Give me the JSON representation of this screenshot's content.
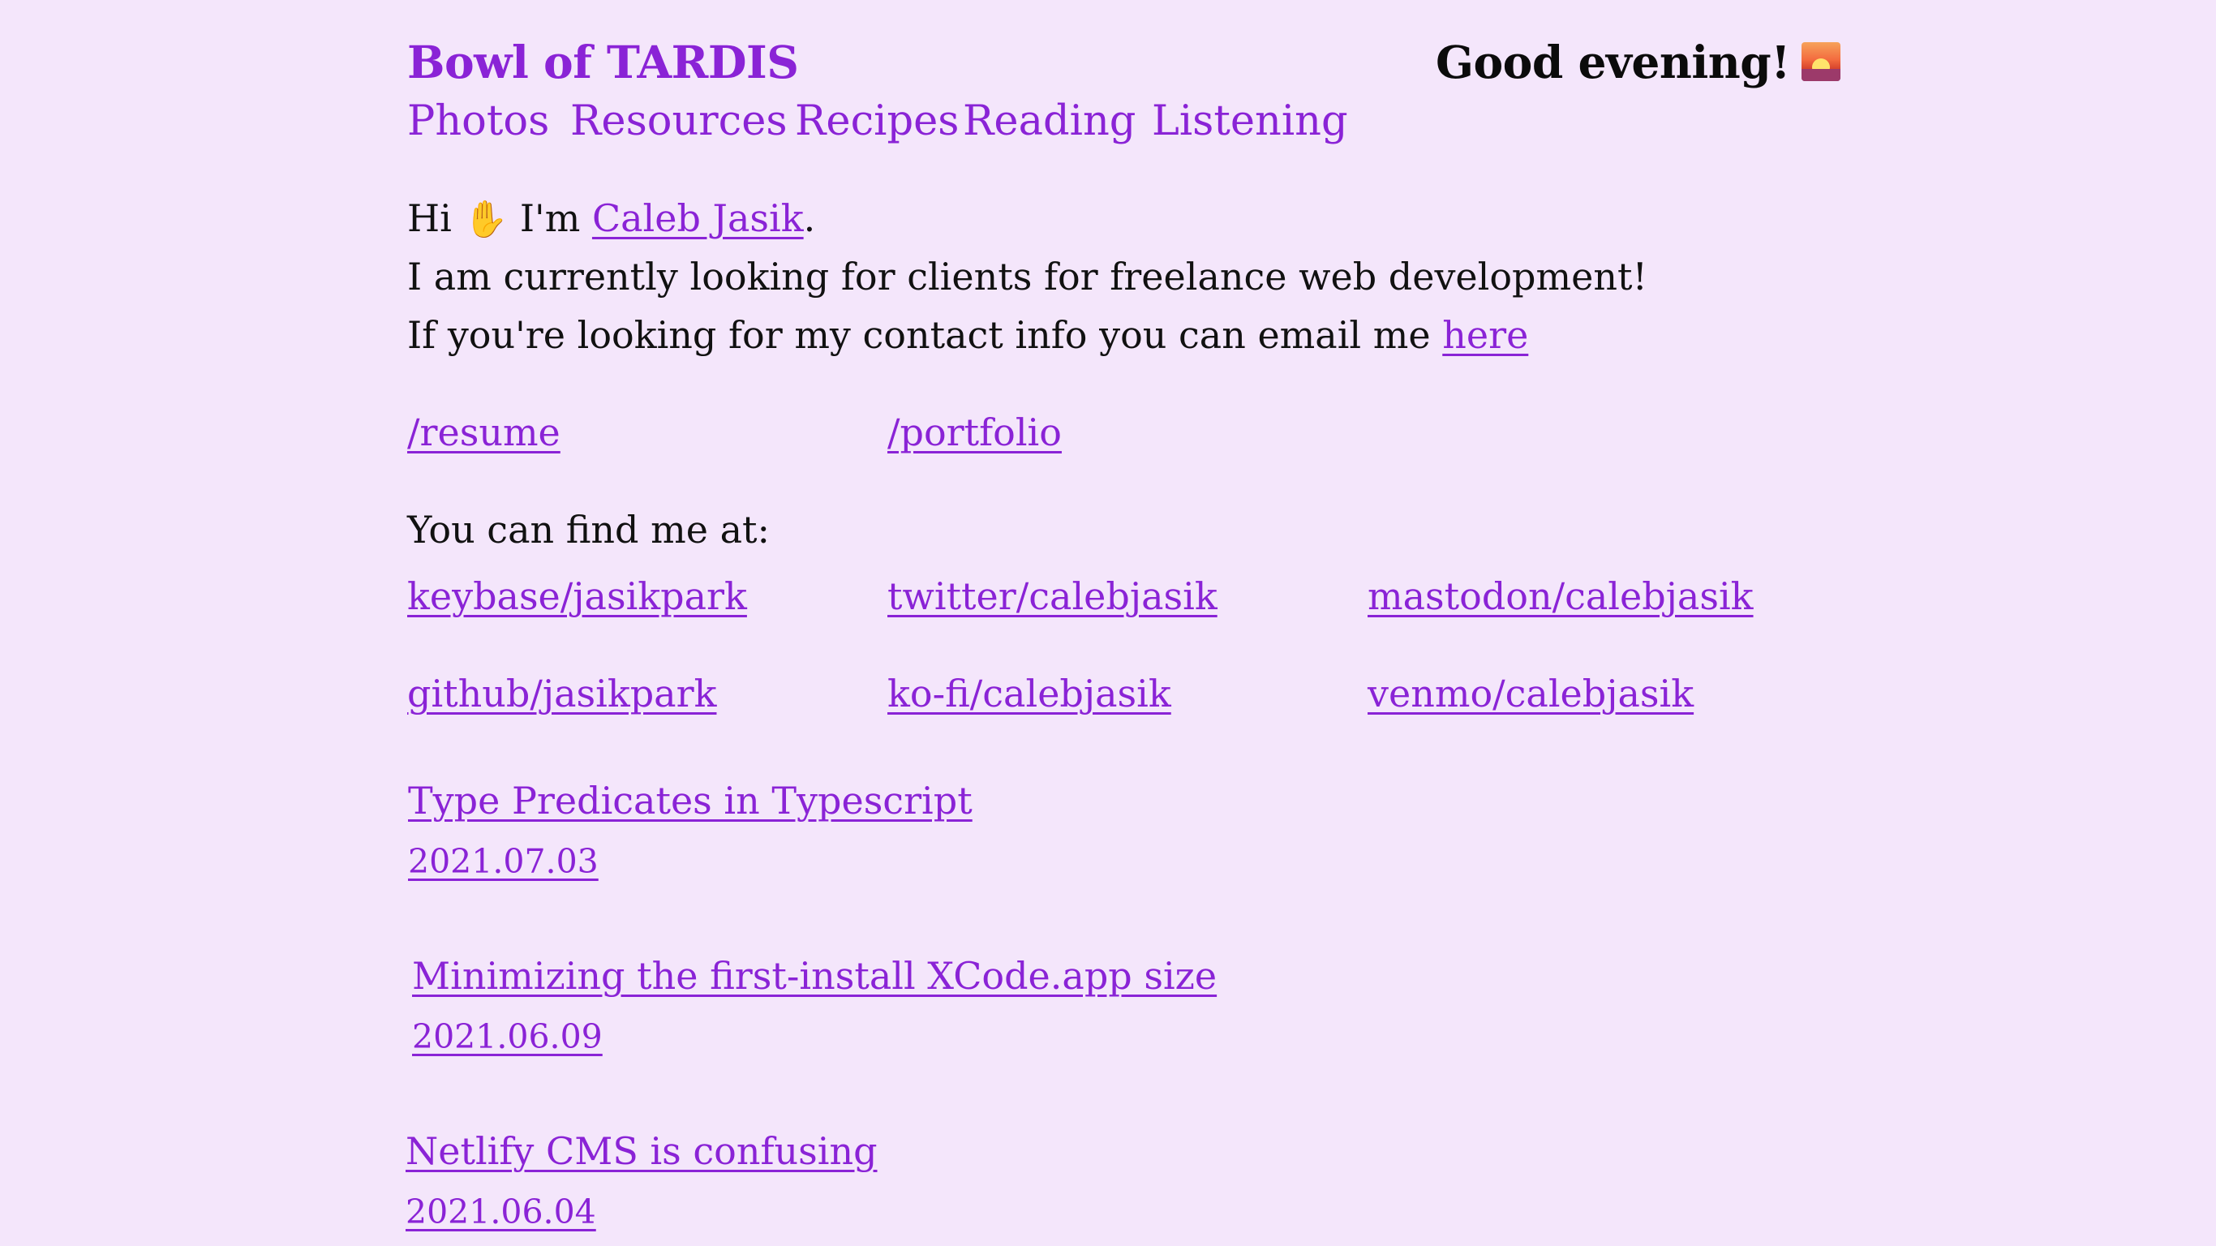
{
  "site": {
    "title": "Bowl of TARDIS",
    "greeting": "Good evening!",
    "greeting_icon": "sunset-icon"
  },
  "nav": {
    "items": [
      {
        "label": "Photos"
      },
      {
        "label": "Resources"
      },
      {
        "label": "Recipes"
      },
      {
        "label": "Reading"
      },
      {
        "label": "Listening"
      }
    ]
  },
  "intro": {
    "hi": "Hi",
    "wave_icon": "waving-hand-icon",
    "im": "I'm",
    "name_link": "Caleb Jasik",
    "period": ".",
    "line2": "I am currently looking for clients for freelance web development!",
    "line3_prefix": "If you're looking for my contact info you can email me",
    "here_link": "here"
  },
  "page_links": [
    {
      "label": "/resume"
    },
    {
      "label": "/portfolio"
    }
  ],
  "find_me": {
    "heading": "You can find me at:",
    "links": [
      {
        "label": "keybase/jasikpark"
      },
      {
        "label": "twitter/calebjasik"
      },
      {
        "label": "mastodon/calebjasik"
      },
      {
        "label": "github/jasikpark"
      },
      {
        "label": "ko-fi/calebjasik"
      },
      {
        "label": "venmo/calebjasik"
      }
    ]
  },
  "posts": [
    {
      "title": "Type Predicates in Typescript",
      "date": "2021.07.03"
    },
    {
      "title": "Minimizing the first-install XCode.app size",
      "date": "2021.06.09"
    },
    {
      "title": "Netlify CMS is confusing",
      "date": "2021.06.04"
    }
  ],
  "colors": {
    "background": "#f4e6fb",
    "accent": "#8a23d6",
    "text": "#111111"
  }
}
